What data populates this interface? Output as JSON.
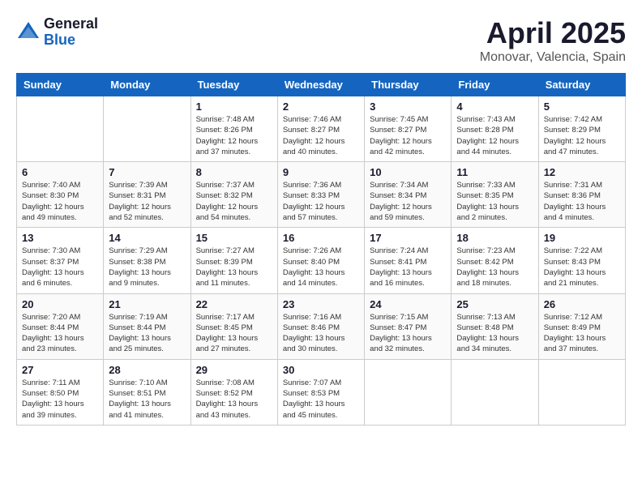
{
  "header": {
    "logo_general": "General",
    "logo_blue": "Blue",
    "title": "April 2025",
    "location": "Monovar, Valencia, Spain"
  },
  "calendar": {
    "days_of_week": [
      "Sunday",
      "Monday",
      "Tuesday",
      "Wednesday",
      "Thursday",
      "Friday",
      "Saturday"
    ],
    "weeks": [
      [
        {
          "day": "",
          "sunrise": "",
          "sunset": "",
          "daylight": ""
        },
        {
          "day": "",
          "sunrise": "",
          "sunset": "",
          "daylight": ""
        },
        {
          "day": "1",
          "sunrise": "Sunrise: 7:48 AM",
          "sunset": "Sunset: 8:26 PM",
          "daylight": "Daylight: 12 hours and 37 minutes."
        },
        {
          "day": "2",
          "sunrise": "Sunrise: 7:46 AM",
          "sunset": "Sunset: 8:27 PM",
          "daylight": "Daylight: 12 hours and 40 minutes."
        },
        {
          "day": "3",
          "sunrise": "Sunrise: 7:45 AM",
          "sunset": "Sunset: 8:27 PM",
          "daylight": "Daylight: 12 hours and 42 minutes."
        },
        {
          "day": "4",
          "sunrise": "Sunrise: 7:43 AM",
          "sunset": "Sunset: 8:28 PM",
          "daylight": "Daylight: 12 hours and 44 minutes."
        },
        {
          "day": "5",
          "sunrise": "Sunrise: 7:42 AM",
          "sunset": "Sunset: 8:29 PM",
          "daylight": "Daylight: 12 hours and 47 minutes."
        }
      ],
      [
        {
          "day": "6",
          "sunrise": "Sunrise: 7:40 AM",
          "sunset": "Sunset: 8:30 PM",
          "daylight": "Daylight: 12 hours and 49 minutes."
        },
        {
          "day": "7",
          "sunrise": "Sunrise: 7:39 AM",
          "sunset": "Sunset: 8:31 PM",
          "daylight": "Daylight: 12 hours and 52 minutes."
        },
        {
          "day": "8",
          "sunrise": "Sunrise: 7:37 AM",
          "sunset": "Sunset: 8:32 PM",
          "daylight": "Daylight: 12 hours and 54 minutes."
        },
        {
          "day": "9",
          "sunrise": "Sunrise: 7:36 AM",
          "sunset": "Sunset: 8:33 PM",
          "daylight": "Daylight: 12 hours and 57 minutes."
        },
        {
          "day": "10",
          "sunrise": "Sunrise: 7:34 AM",
          "sunset": "Sunset: 8:34 PM",
          "daylight": "Daylight: 12 hours and 59 minutes."
        },
        {
          "day": "11",
          "sunrise": "Sunrise: 7:33 AM",
          "sunset": "Sunset: 8:35 PM",
          "daylight": "Daylight: 13 hours and 2 minutes."
        },
        {
          "day": "12",
          "sunrise": "Sunrise: 7:31 AM",
          "sunset": "Sunset: 8:36 PM",
          "daylight": "Daylight: 13 hours and 4 minutes."
        }
      ],
      [
        {
          "day": "13",
          "sunrise": "Sunrise: 7:30 AM",
          "sunset": "Sunset: 8:37 PM",
          "daylight": "Daylight: 13 hours and 6 minutes."
        },
        {
          "day": "14",
          "sunrise": "Sunrise: 7:29 AM",
          "sunset": "Sunset: 8:38 PM",
          "daylight": "Daylight: 13 hours and 9 minutes."
        },
        {
          "day": "15",
          "sunrise": "Sunrise: 7:27 AM",
          "sunset": "Sunset: 8:39 PM",
          "daylight": "Daylight: 13 hours and 11 minutes."
        },
        {
          "day": "16",
          "sunrise": "Sunrise: 7:26 AM",
          "sunset": "Sunset: 8:40 PM",
          "daylight": "Daylight: 13 hours and 14 minutes."
        },
        {
          "day": "17",
          "sunrise": "Sunrise: 7:24 AM",
          "sunset": "Sunset: 8:41 PM",
          "daylight": "Daylight: 13 hours and 16 minutes."
        },
        {
          "day": "18",
          "sunrise": "Sunrise: 7:23 AM",
          "sunset": "Sunset: 8:42 PM",
          "daylight": "Daylight: 13 hours and 18 minutes."
        },
        {
          "day": "19",
          "sunrise": "Sunrise: 7:22 AM",
          "sunset": "Sunset: 8:43 PM",
          "daylight": "Daylight: 13 hours and 21 minutes."
        }
      ],
      [
        {
          "day": "20",
          "sunrise": "Sunrise: 7:20 AM",
          "sunset": "Sunset: 8:44 PM",
          "daylight": "Daylight: 13 hours and 23 minutes."
        },
        {
          "day": "21",
          "sunrise": "Sunrise: 7:19 AM",
          "sunset": "Sunset: 8:44 PM",
          "daylight": "Daylight: 13 hours and 25 minutes."
        },
        {
          "day": "22",
          "sunrise": "Sunrise: 7:17 AM",
          "sunset": "Sunset: 8:45 PM",
          "daylight": "Daylight: 13 hours and 27 minutes."
        },
        {
          "day": "23",
          "sunrise": "Sunrise: 7:16 AM",
          "sunset": "Sunset: 8:46 PM",
          "daylight": "Daylight: 13 hours and 30 minutes."
        },
        {
          "day": "24",
          "sunrise": "Sunrise: 7:15 AM",
          "sunset": "Sunset: 8:47 PM",
          "daylight": "Daylight: 13 hours and 32 minutes."
        },
        {
          "day": "25",
          "sunrise": "Sunrise: 7:13 AM",
          "sunset": "Sunset: 8:48 PM",
          "daylight": "Daylight: 13 hours and 34 minutes."
        },
        {
          "day": "26",
          "sunrise": "Sunrise: 7:12 AM",
          "sunset": "Sunset: 8:49 PM",
          "daylight": "Daylight: 13 hours and 37 minutes."
        }
      ],
      [
        {
          "day": "27",
          "sunrise": "Sunrise: 7:11 AM",
          "sunset": "Sunset: 8:50 PM",
          "daylight": "Daylight: 13 hours and 39 minutes."
        },
        {
          "day": "28",
          "sunrise": "Sunrise: 7:10 AM",
          "sunset": "Sunset: 8:51 PM",
          "daylight": "Daylight: 13 hours and 41 minutes."
        },
        {
          "day": "29",
          "sunrise": "Sunrise: 7:08 AM",
          "sunset": "Sunset: 8:52 PM",
          "daylight": "Daylight: 13 hours and 43 minutes."
        },
        {
          "day": "30",
          "sunrise": "Sunrise: 7:07 AM",
          "sunset": "Sunset: 8:53 PM",
          "daylight": "Daylight: 13 hours and 45 minutes."
        },
        {
          "day": "",
          "sunrise": "",
          "sunset": "",
          "daylight": ""
        },
        {
          "day": "",
          "sunrise": "",
          "sunset": "",
          "daylight": ""
        },
        {
          "day": "",
          "sunrise": "",
          "sunset": "",
          "daylight": ""
        }
      ]
    ]
  }
}
